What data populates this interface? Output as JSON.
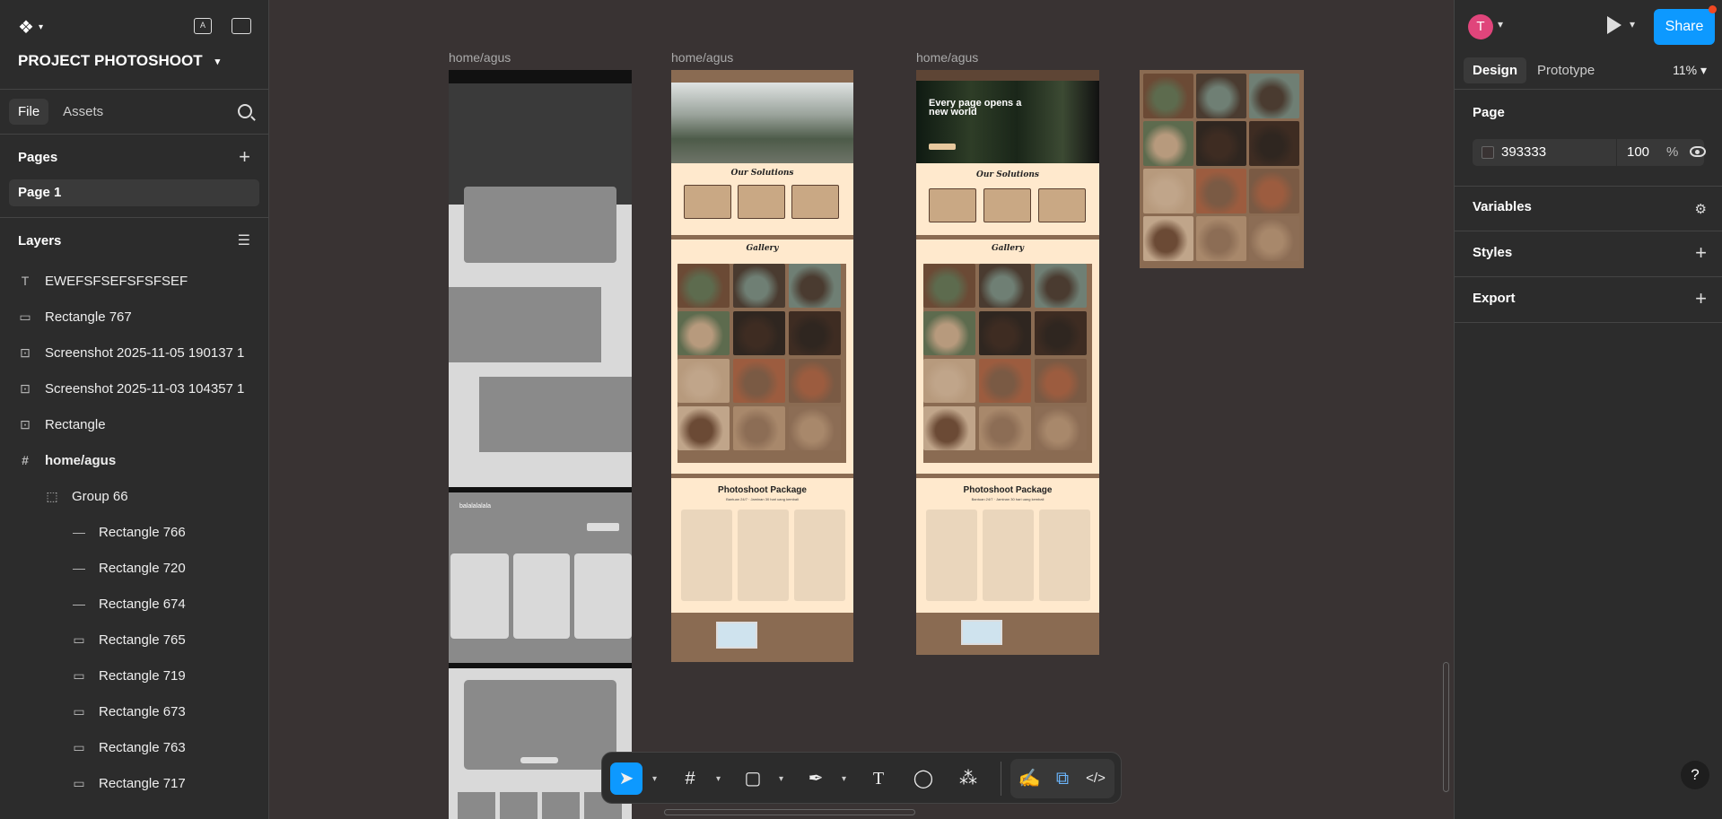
{
  "app": {
    "name": "Figma"
  },
  "header": {
    "project_title": "PROJECT PHOTOSHOOT"
  },
  "left_tabs": {
    "file": "File",
    "assets": "Assets"
  },
  "pages": {
    "title": "Pages",
    "items": [
      "Page 1"
    ]
  },
  "layers": {
    "title": "Layers",
    "items": [
      {
        "label": "EWEFSFSEFSFSFSEF",
        "icon": "text-icon"
      },
      {
        "label": "Rectangle 767",
        "icon": "rectangle-icon"
      },
      {
        "label": "Screenshot 2025-11-05 190137 1",
        "icon": "image-icon"
      },
      {
        "label": "Screenshot 2025-11-03 104357 1",
        "icon": "image-icon"
      },
      {
        "label": "Rectangle",
        "icon": "image-icon"
      },
      {
        "label": "home/agus",
        "icon": "frame-icon"
      },
      {
        "label": "Group 66",
        "icon": "group-icon"
      },
      {
        "label": "Rectangle 766",
        "icon": "line-icon"
      },
      {
        "label": "Rectangle 720",
        "icon": "line-icon"
      },
      {
        "label": "Rectangle 674",
        "icon": "line-icon"
      },
      {
        "label": "Rectangle 765",
        "icon": "rectangle-icon"
      },
      {
        "label": "Rectangle 719",
        "icon": "rectangle-icon"
      },
      {
        "label": "Rectangle 673",
        "icon": "rectangle-icon"
      },
      {
        "label": "Rectangle 763",
        "icon": "rectangle-icon"
      },
      {
        "label": "Rectangle 717",
        "icon": "rectangle-icon"
      }
    ]
  },
  "right": {
    "avatar_letter": "T",
    "share_label": "Share",
    "tabs": {
      "design": "Design",
      "prototype": "Prototype"
    },
    "zoom": "11%",
    "page_section": "Page",
    "page_color": "393333",
    "page_opacity": "100",
    "percent": "%",
    "variables": "Variables",
    "styles": "Styles",
    "export": "Export",
    "help": "?"
  },
  "canvas": {
    "frame_labels": [
      "home/agus",
      "home/agus",
      "home/agus"
    ],
    "wireframe_text": "balalalalala",
    "hero_title": "Every page opens a new world",
    "solutions_title": "Our Solutions",
    "gallery_title": "Gallery",
    "package_title": "Photoshoot Package",
    "package_subtitle": "Bantuan 24/7 · Jaminan 30 hari uang kembali"
  },
  "colors": {
    "canvas": "#393333",
    "accent": "#0d99ff",
    "site_bg": "#ffe9cd",
    "site_brown": "#8a6b52"
  }
}
